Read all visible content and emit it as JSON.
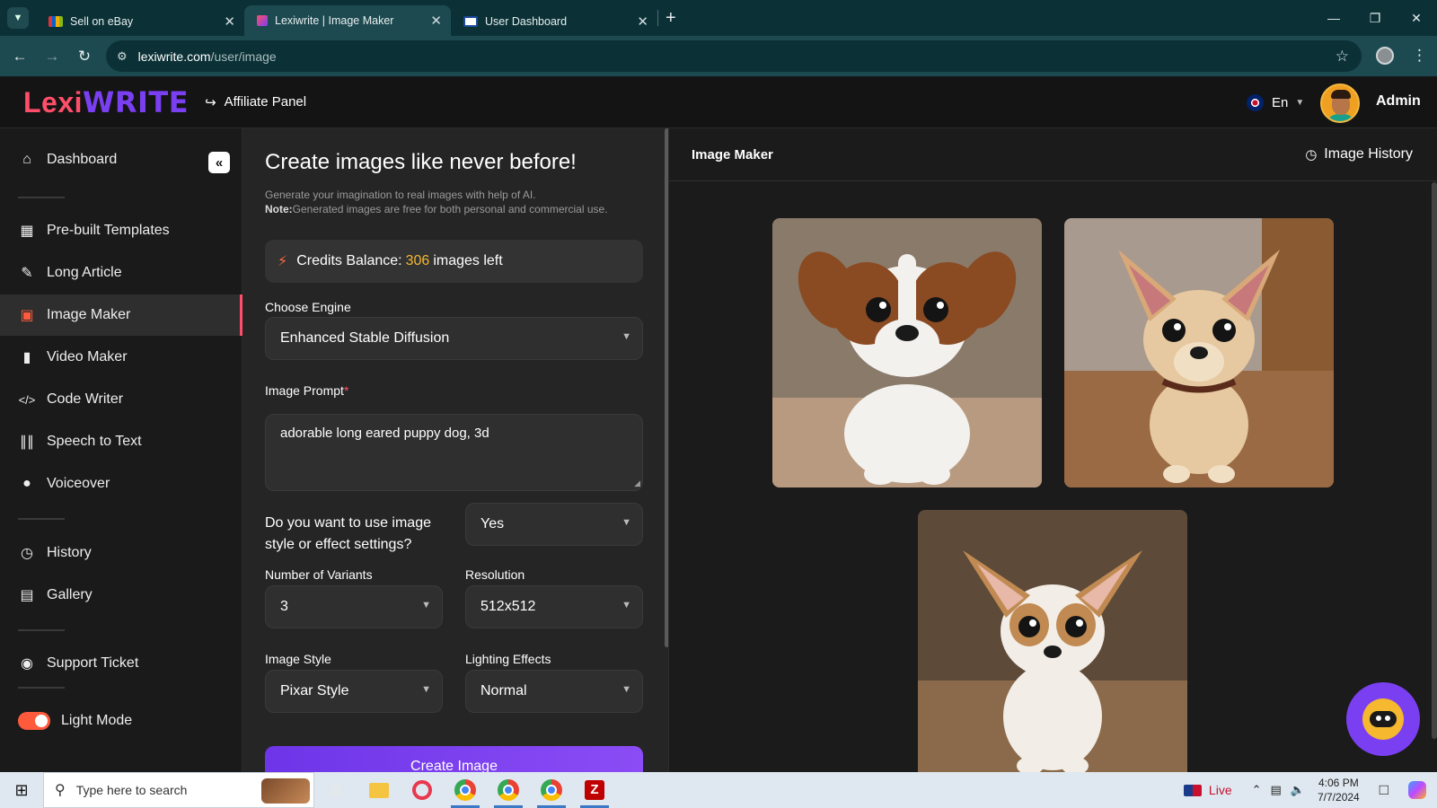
{
  "browser": {
    "tabs": [
      {
        "title": "Sell on eBay",
        "active": false
      },
      {
        "title": "Lexiwrite | Image Maker",
        "active": true
      },
      {
        "title": "User Dashboard",
        "active": false
      }
    ],
    "url_host": "lexiwrite.com",
    "url_path": "/user/image"
  },
  "header": {
    "logo_part1": "Lexi",
    "logo_part2": "WRITE",
    "affiliate_label": "Affiliate Panel",
    "language": "En",
    "user_name": "Admin"
  },
  "sidebar": {
    "items": [
      {
        "label": "Dashboard",
        "icon": "home-icon"
      },
      {
        "label": "Pre-built Templates",
        "icon": "grid-icon"
      },
      {
        "label": "Long Article",
        "icon": "pen-icon"
      },
      {
        "label": "Image Maker",
        "icon": "image-icon",
        "active": true
      },
      {
        "label": "Video Maker",
        "icon": "video-icon"
      },
      {
        "label": "Code Writer",
        "icon": "code-icon"
      },
      {
        "label": "Speech to Text",
        "icon": "waveform-icon"
      },
      {
        "label": "Voiceover",
        "icon": "microphone-icon"
      },
      {
        "label": "History",
        "icon": "history-icon"
      },
      {
        "label": "Gallery",
        "icon": "gallery-icon"
      },
      {
        "label": "Support Ticket",
        "icon": "support-icon"
      }
    ],
    "mode_label": "Light Mode"
  },
  "form": {
    "title": "Create images like never before!",
    "subtitle": "Generate your imagination to real images with help of AI.",
    "note_label": "Note:",
    "note_text": "Generated images are free for both personal and commercial use.",
    "credits_prefix": "Credits Balance:",
    "credits_value": "306",
    "credits_suffix": "images left",
    "engine_label": "Choose Engine",
    "engine_value": "Enhanced Stable Diffusion",
    "prompt_label": "Image Prompt",
    "prompt_required": "*",
    "prompt_value": "adorable long eared puppy dog, 3d",
    "style_question": "Do you want to use image style or effect settings?",
    "style_toggle_value": "Yes",
    "variants_label": "Number of Variants",
    "variants_value": "3",
    "resolution_label": "Resolution",
    "resolution_value": "512x512",
    "image_style_label": "Image Style",
    "image_style_value": "Pixar Style",
    "lighting_label": "Lighting Effects",
    "lighting_value": "Normal",
    "create_button": "Create Image"
  },
  "results": {
    "title": "Image Maker",
    "history_label": "Image History",
    "images": [
      {
        "name": "puppy-1",
        "colors": {
          "bg": "#8a7a6a",
          "fur": "#f3f1ee",
          "patch": "#8a4a22"
        }
      },
      {
        "name": "puppy-2",
        "colors": {
          "bg": "#a89a8e",
          "fur": "#e6c9a0",
          "patch": "#d8a878"
        }
      },
      {
        "name": "puppy-3",
        "colors": {
          "bg": "#5e4a38",
          "fur": "#f2ede6",
          "patch": "#c08a52"
        }
      }
    ]
  },
  "taskbar": {
    "search_placeholder": "Type here to search",
    "live_label": "Live",
    "time": "4:06 PM",
    "date": "7/7/2024"
  },
  "colors": {
    "accent": "#7b3ff2",
    "brand_red": "#ff4e6a",
    "credits_highlight": "#f5b82e"
  }
}
